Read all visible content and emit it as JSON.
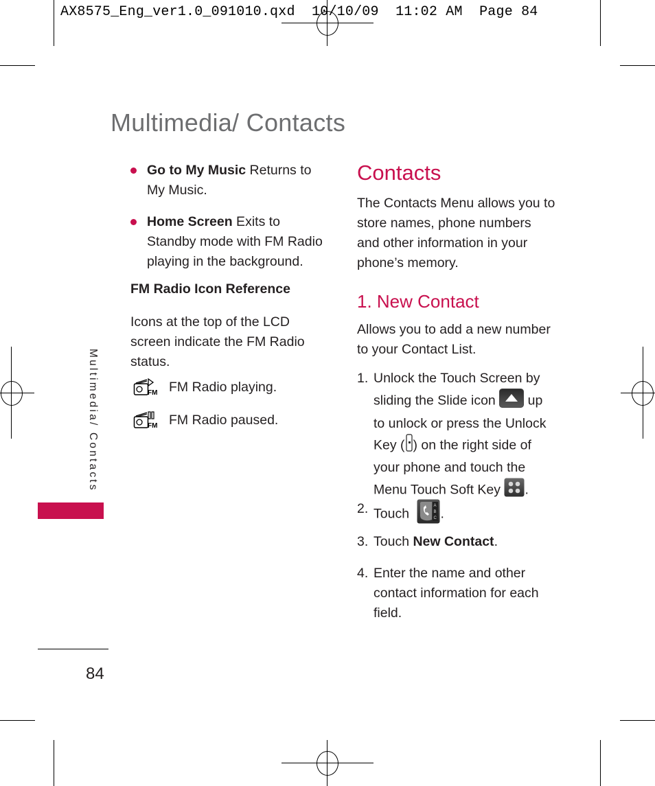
{
  "slug": "AX8575_Eng_ver1.0_091010.qxd  10/10/09  11:02 AM  Page 84",
  "page_title": "Multimedia/ Contacts",
  "left_column": {
    "bullets": [
      {
        "bold": "Go to My Music",
        "text_line1": " Returns to",
        "text_rest": "My Music."
      },
      {
        "bold": "Home Screen",
        "text_line1": " Exits to",
        "text_rest": "Standby mode with FM Radio playing in the background."
      }
    ],
    "subheading": "FM Radio Icon Reference",
    "paragraph": "Icons at the top of the LCD screen indicate the FM Radio status.",
    "icon_reference": [
      {
        "icon": "fm-radio-playing-icon",
        "label": "FM Radio playing."
      },
      {
        "icon": "fm-radio-paused-icon",
        "label": "FM Radio paused."
      }
    ]
  },
  "right_column": {
    "heading": "Contacts",
    "intro": "The Contacts Menu allows you to store names, phone numbers and other information in your phone’s memory.",
    "subsection_heading": "1. New Contact",
    "subsection_intro": "Allows you to add a new number to your Contact List.",
    "steps": [
      {
        "num": "1.",
        "parts": {
          "a": "Unlock the Touch Screen by sliding the Slide icon",
          "b": "up to unlock or press the Unlock Key (",
          "c": ") on the right side of your phone and touch the Menu Touch Soft Key",
          "d": "."
        }
      },
      {
        "num": "2.",
        "text": "Touch",
        "after": "."
      },
      {
        "num": "3.",
        "text": "Touch ",
        "bold": "New Contact",
        "after": "."
      },
      {
        "num": "4.",
        "text": "Enter the name and other contact information for each field."
      }
    ]
  },
  "side_tab": {
    "label": "Multimedia/ Contacts",
    "color": "#c8104e"
  },
  "page_number": "84",
  "colors": {
    "accent": "#c8104e",
    "title_gray": "#6d6e70",
    "text": "#231f20"
  }
}
